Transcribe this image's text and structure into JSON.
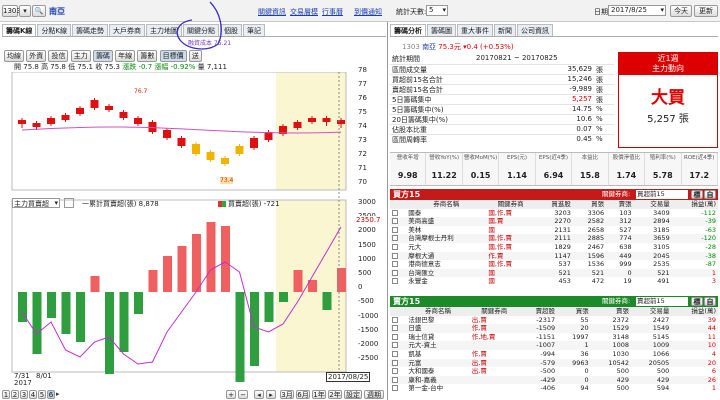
{
  "top": {
    "stock_code": "1303",
    "stock_name": "南亞",
    "links": [
      "關鍵資訊",
      "交易層模",
      "行事曆",
      "到價通知"
    ]
  },
  "left_tabs": [
    "籌碼K線",
    "分點K線",
    "籌碼走勢",
    "大戶券商",
    "主力地圖",
    "關鍵分點",
    "個股",
    "筆記"
  ],
  "sub_tabs": [
    "均線",
    "外資",
    "投信",
    "主力",
    "籌碼",
    "年線",
    "籌數",
    "目標價",
    "送"
  ],
  "ohlc": {
    "open_label": "開",
    "open": "75.8",
    "high_label": "高",
    "high": "75.8",
    "low_label": "低",
    "low": "75.1",
    "close_label": "收",
    "close": "75.3",
    "change_label": "漲跌",
    "change": "-0.7",
    "pct_label": "漲幅",
    "pct": "-0.92%",
    "vol_label": "量",
    "vol": "7,111"
  },
  "annot_handwritten": "融資成本 75.21",
  "candle_marks": {
    "hi": "76.7",
    "lo": "73.4"
  },
  "candle_y_ticks": [
    "78",
    "77",
    "76",
    "75",
    "74",
    "73",
    "72",
    "71",
    "70"
  ],
  "lower": {
    "select": "主力買賣超",
    "legend1": "一累計買賣超(張) 8,878",
    "legend2": "買賣超(張) -721",
    "y_ticks": [
      "3000",
      "2500",
      "2000",
      "1500",
      "1000",
      "500",
      "0",
      "-500",
      "-1000",
      "-1500",
      "-2000",
      "-2500"
    ],
    "last_val": "2350.7"
  },
  "dates": {
    "d1": "7/31",
    "d2": "8/01",
    "year": "2017",
    "cursor": "2017/08/25"
  },
  "pager": [
    "1",
    "2",
    "3",
    "4",
    "5",
    "6"
  ],
  "zoom_btns": [
    "3月",
    "6月",
    "1年",
    "2年",
    "設定",
    "週期"
  ],
  "stat": {
    "label": "統計天數:",
    "days": "5",
    "date_label": "日期:",
    "date": "2017/8/25",
    "today_btn": "今天",
    "update_btn": "更新"
  },
  "r_tabs": [
    "籌碼分析",
    "籌碼圖",
    "重大事件",
    "新聞",
    "公司資訊"
  ],
  "summary": {
    "title_code": "1303",
    "title_name": "南亞",
    "title_price": "75.3元",
    "title_chg": "▾0.4 (+0.53%)",
    "range_label": "統計期間",
    "range": "20170821 ~ 20170825",
    "rows": [
      {
        "k": "區間成交量",
        "v": "35,629",
        "u": "張"
      },
      {
        "k": "買超前15名合計",
        "v": "15,246",
        "u": "張"
      },
      {
        "k": "賣超前15名合計",
        "v": "-9,989",
        "u": "張"
      },
      {
        "k": "5日籌碼集中",
        "v": "5,257",
        "u": "張"
      },
      {
        "k": "5日籌碼集中(%)",
        "v": "14.75",
        "u": "%"
      },
      {
        "k": "20日籌碼集中(%)",
        "v": "10.6",
        "u": "%"
      },
      {
        "k": "佔股本比重",
        "v": "0.07",
        "u": "%"
      },
      {
        "k": "區間周轉率",
        "v": "0.45",
        "u": "%"
      }
    ],
    "badge_top": "近1週",
    "badge_sub": "主力動向",
    "badge_big": "大買",
    "badge_val": "5,257 張"
  },
  "metrics": {
    "heads": [
      "營收年增",
      "營收YoY(%)",
      "營收MoM(%)",
      "EPS(元)",
      "EPS(近4季)",
      "本益比",
      "股價淨值比",
      "殖利率(%)",
      "ROE(近4季)"
    ],
    "vals": [
      "9.98",
      "11.22",
      "0.15",
      "1.14",
      "6.94",
      "15.8",
      "1.74",
      "5.78",
      "17.2"
    ]
  },
  "buy": {
    "title": "買方15",
    "key_label": "關鍵券商:",
    "select": "買超前15",
    "btn1": "標",
    "btn2": "自",
    "heads": [
      "",
      "券商名稱",
      "關鍵券商",
      "買進股",
      "買張",
      "賣張",
      "交易量",
      "損益(萬)"
    ],
    "rows": [
      [
        "國泰",
        "國,作,賈",
        "3203",
        "3306",
        "103",
        "3409",
        "-112"
      ],
      [
        "美商高盛",
        "國,賈",
        "2270",
        "2582",
        "312",
        "2894",
        "-39"
      ],
      [
        "美林",
        "國",
        "2131",
        "2658",
        "527",
        "3185",
        "-63"
      ],
      [
        "台灣摩根士丹利",
        "國,作,賈",
        "2111",
        "2885",
        "774",
        "3659",
        "-120"
      ],
      [
        "元大",
        "國,作,賈",
        "1829",
        "2467",
        "638",
        "3105",
        "-28"
      ],
      [
        "摩根大通",
        "作,賈",
        "1147",
        "1596",
        "449",
        "2045",
        "-38"
      ],
      [
        "港商德意志",
        "國,作,賈",
        "537",
        "1536",
        "999",
        "2535",
        "-87"
      ],
      [
        "台灣匯立",
        "國",
        "521",
        "521",
        "0",
        "521",
        "1"
      ],
      [
        "永豐金",
        "國",
        "453",
        "472",
        "19",
        "491",
        "3"
      ]
    ]
  },
  "sell": {
    "title": "賣方15",
    "key_label": "關鍵券商:",
    "select": "賣超前15",
    "btn1": "標",
    "btn2": "自",
    "heads": [
      "",
      "券商名稱",
      "關鍵券商",
      "賣超股",
      "買張",
      "賣張",
      "交易量",
      "損益(萬)"
    ],
    "rows": [
      [
        "法銀巴黎",
        "出,賈",
        "-2317",
        "55",
        "2372",
        "2427",
        "39"
      ],
      [
        "日盛",
        "作,賈",
        "-1509",
        "20",
        "1529",
        "1549",
        "44"
      ],
      [
        "瑞士信貸",
        "作,地,賈",
        "-1151",
        "1997",
        "3148",
        "5145",
        "11"
      ],
      [
        "元大-資土",
        "",
        "-1007",
        "1",
        "1008",
        "1009",
        "10"
      ],
      [
        "凱基",
        "作,賈",
        "-994",
        "36",
        "1030",
        "1066",
        "4"
      ],
      [
        "元富",
        "出,賈",
        "-579",
        "9963",
        "10542",
        "20505",
        "20"
      ],
      [
        "大和國泰",
        "出,賈",
        "-500",
        "0",
        "500",
        "500",
        "6"
      ],
      [
        "康和-嘉義",
        "",
        "-429",
        "0",
        "429",
        "429",
        "26"
      ],
      [
        "第一金-台中",
        "",
        "-406",
        "94",
        "500",
        "594",
        "1"
      ]
    ]
  }
}
